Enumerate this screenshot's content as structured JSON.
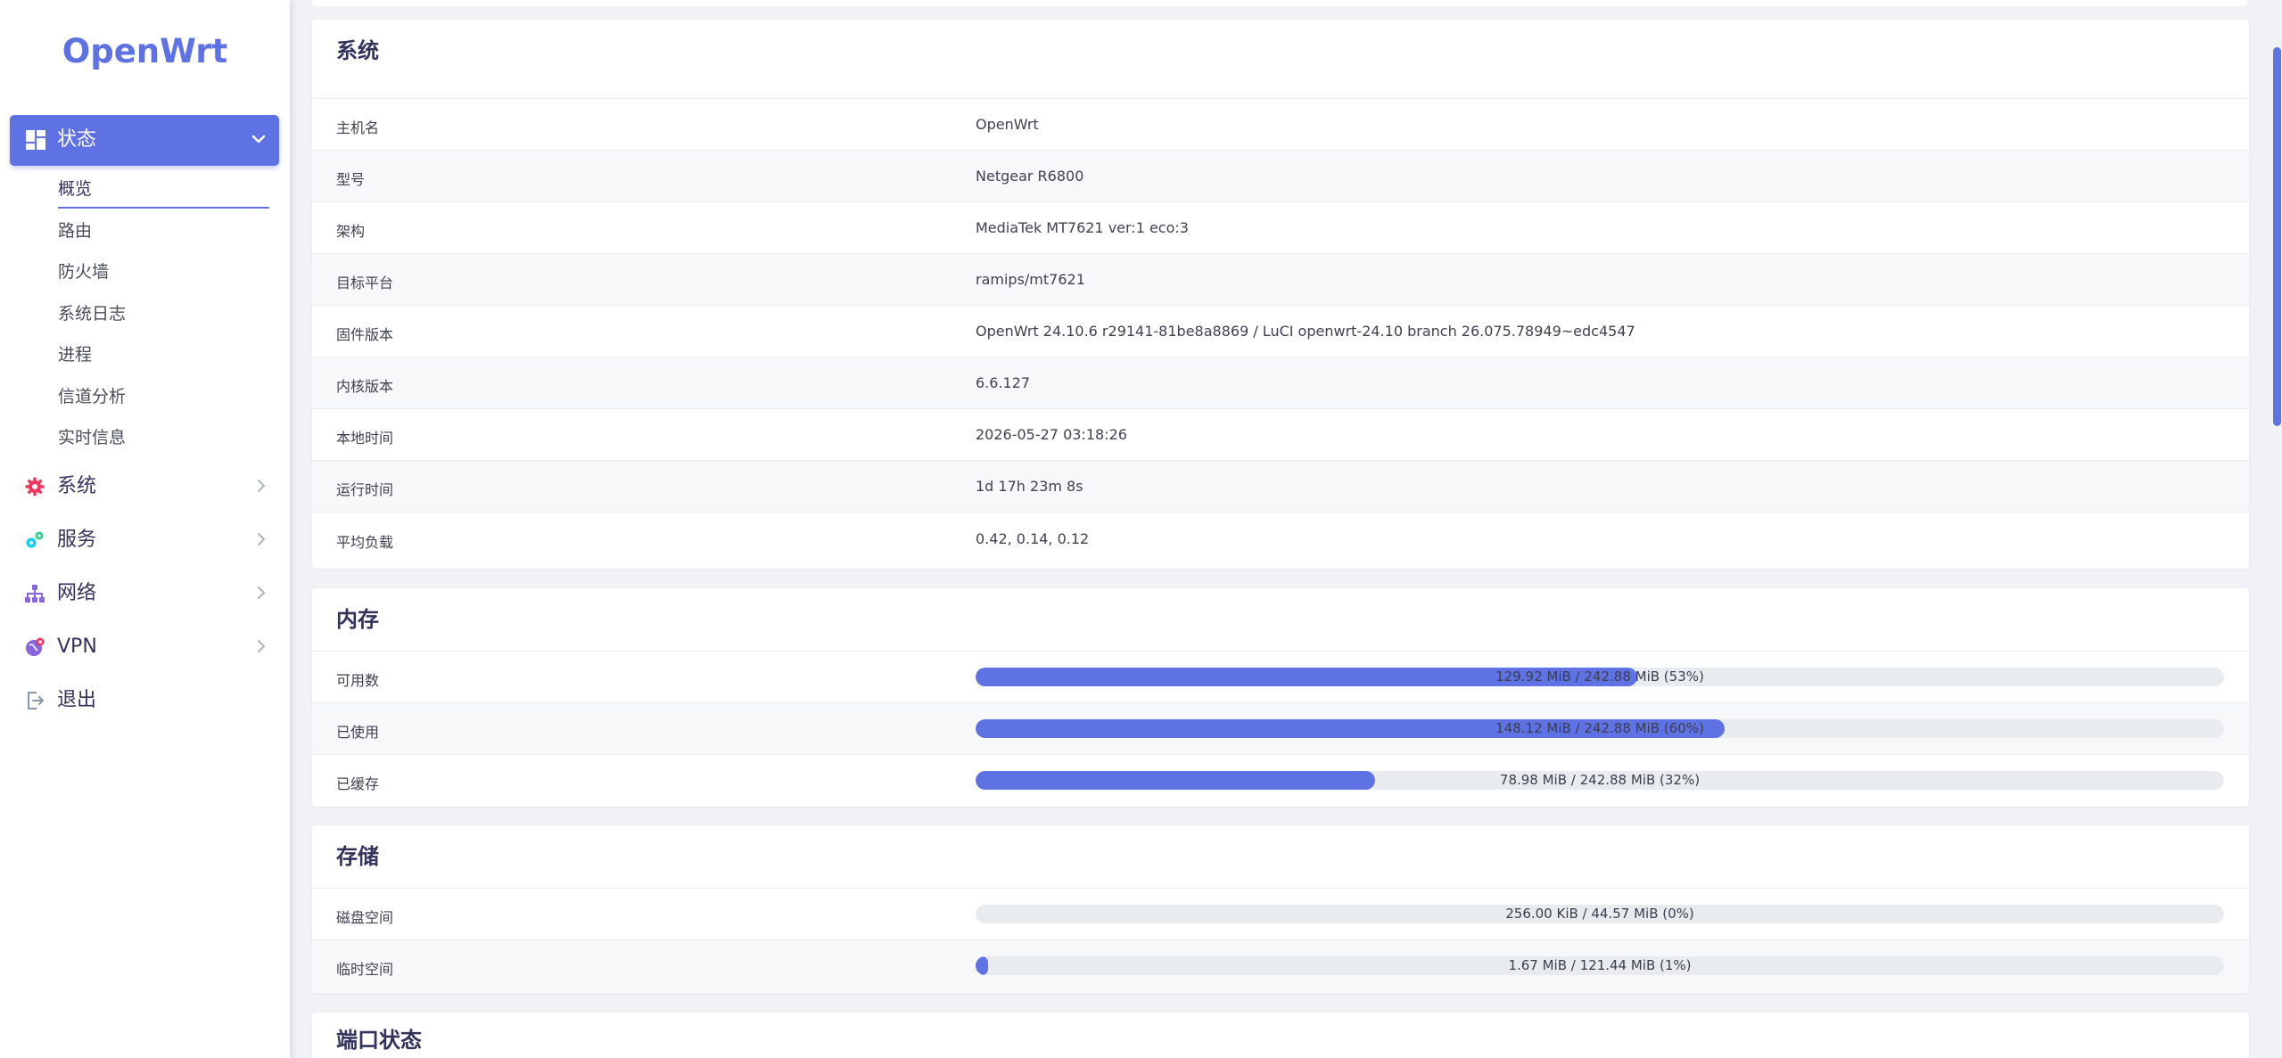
{
  "brand": "OpenWrt",
  "sidebar": {
    "active": {
      "label": "状态",
      "icon": "dashboard-icon"
    },
    "subitems": [
      "概览",
      "路由",
      "防火墙",
      "系统日志",
      "进程",
      "信道分析",
      "实时信息"
    ],
    "items": [
      {
        "label": "系统",
        "icon": "gear-icon"
      },
      {
        "label": "服务",
        "icon": "services-icon"
      },
      {
        "label": "网络",
        "icon": "network-icon"
      },
      {
        "label": "VPN",
        "icon": "vpn-icon"
      },
      {
        "label": "退出",
        "icon": "logout-icon"
      }
    ]
  },
  "system": {
    "title": "系统",
    "rows": [
      {
        "k": "主机名",
        "v": "OpenWrt"
      },
      {
        "k": "型号",
        "v": "Netgear R6800"
      },
      {
        "k": "架构",
        "v": "MediaTek MT7621 ver:1 eco:3"
      },
      {
        "k": "目标平台",
        "v": "ramips/mt7621"
      },
      {
        "k": "固件版本",
        "v": "OpenWrt 24.10.6 r29141-81be8a8869 / LuCI openwrt-24.10 branch 26.075.78949~edc4547"
      },
      {
        "k": "内核版本",
        "v": "6.6.127"
      },
      {
        "k": "本地时间",
        "v": "2026-05-27 03:18:26"
      },
      {
        "k": "运行时间",
        "v": "1d 17h 23m 8s"
      },
      {
        "k": "平均负载",
        "v": "0.42, 0.14, 0.12"
      }
    ]
  },
  "memory": {
    "title": "内存",
    "rows": [
      {
        "k": "可用数",
        "text": "129.92 MiB / 242.88 MiB (53%)",
        "percent": 53
      },
      {
        "k": "已使用",
        "text": "148.12 MiB / 242.88 MiB (60%)",
        "percent": 60
      },
      {
        "k": "已缓存",
        "text": "78.98 MiB / 242.88 MiB (32%)",
        "percent": 32
      }
    ]
  },
  "storage": {
    "title": "存储",
    "rows": [
      {
        "k": "磁盘空间",
        "text": "256.00 KiB / 44.57 MiB (0%)",
        "percent": 0
      },
      {
        "k": "临时空间",
        "text": "1.67 MiB / 121.44 MiB (1%)",
        "percent": 1
      }
    ]
  },
  "ports": {
    "title": "端口状态"
  },
  "colors": {
    "accent": "#5e72e4",
    "gear": "#f5365c",
    "services": "#11cdef",
    "network": "#8965e0",
    "vpn": "#8965e0",
    "logout": "#8898aa"
  }
}
